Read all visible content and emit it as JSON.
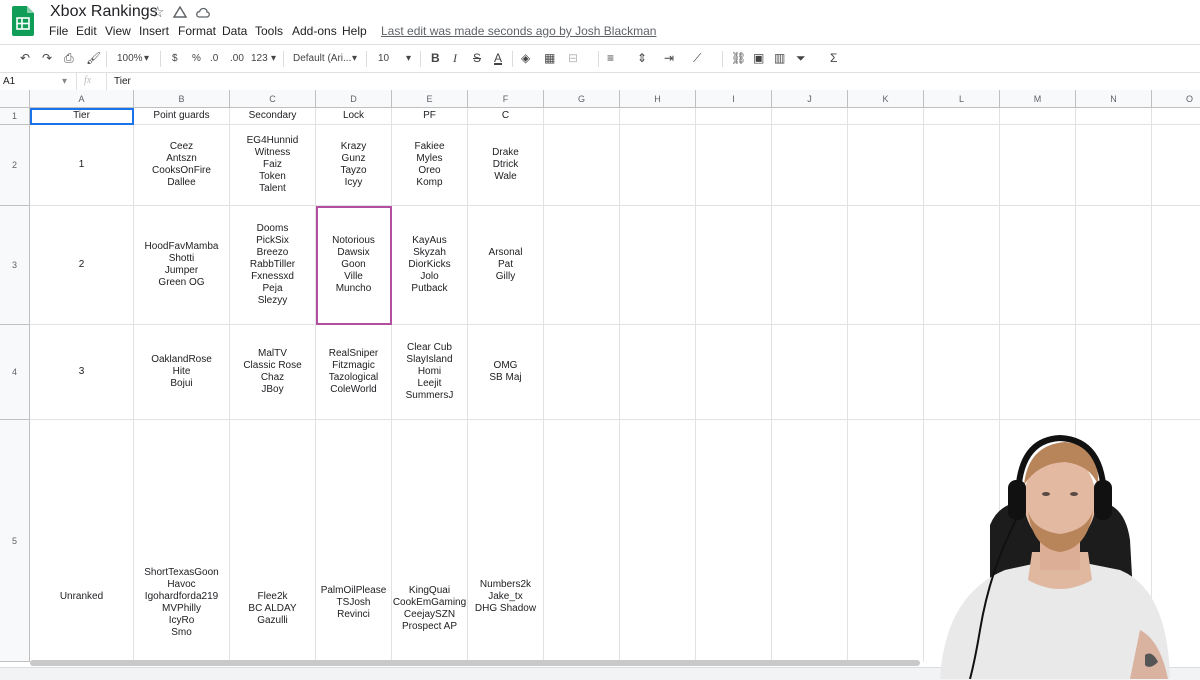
{
  "app": {
    "title": "Xbox Rankings",
    "last_edit": "Last edit was made seconds ago by Josh Blackman",
    "menu": [
      "File",
      "Edit",
      "View",
      "Insert",
      "Format",
      "Data",
      "Tools",
      "Add-ons",
      "Help"
    ]
  },
  "toolbar": {
    "zoom": "100%",
    "currency": "$",
    "percent": "%",
    "dec_decrease": ".0",
    "dec_increase": ".00",
    "format_more": "123",
    "font": "Default (Ari...",
    "font_size": "10",
    "bold": "B",
    "italic": "I",
    "strike": "S",
    "text_color": "A",
    "sum": "Σ"
  },
  "formula_bar": {
    "cell_ref": "A1",
    "fx": "fx",
    "content": "Tier"
  },
  "columns": [
    "A",
    "B",
    "C",
    "D",
    "E",
    "F",
    "G",
    "H",
    "I",
    "J",
    "K",
    "L",
    "M",
    "N",
    "O"
  ],
  "rows": [
    {
      "num": "1",
      "cells": [
        "Tier",
        "Point guards",
        "Secondary",
        "Lock",
        "PF",
        "C"
      ]
    },
    {
      "num": "2",
      "cells": [
        "1",
        "Ceez\nAntszn\nCooksOnFire\nDallee",
        "EG4Hunnid\nWitness\nFaiz\nToken\nTalent",
        "Krazy\nGunz\nTayzo\nIcyy",
        "Fakiee\nMyles\nOreo\nKomp",
        "Drake\nDtrick\nWale"
      ]
    },
    {
      "num": "3",
      "cells": [
        "2",
        "HoodFavMamba\nShotti\nJumper\nGreen OG",
        "Dooms\nPickSix\nBreezo\nRabbTiller\nFxnessxd\nPeja\nSlezyy",
        "Notorious\nDawsix\nGoon\nVille\nMuncho",
        "KayAus\nSkyzah\nDiorKicks\nJolo\nPutback",
        "Arsonal\nPat\nGilly"
      ]
    },
    {
      "num": "4",
      "cells": [
        "3",
        "OaklandRose\nHite\nBojui",
        "MalTV\nClassic Rose\nChaz\nJBoy",
        "RealSniper\nFitzmagic\nTazological\nColeWorld",
        "Clear Cub\nSlayIsland\nHomi\nLeejit\nSummersJ",
        "OMG\nSB Maj"
      ]
    },
    {
      "num": "5",
      "cells": [
        "Unranked",
        "ShortTexasGoon\nHavoc\nIgohardforda219\nMVPhilly\nIcyRo\nSmo",
        "Flee2k\nBC ALDAY\nGazulli",
        "PalmOilPlease\nTSJosh\nRevinci",
        "KingQuai\nCookEmGaming\nCeejaySZN\nProspect AP",
        "Numbers2k\nJake_tx\nDHG Shadow"
      ]
    }
  ],
  "colors": {
    "accent": "#1a73e8",
    "selected_range": "#b24fa1",
    "sheets_green": "#0f9d58"
  }
}
